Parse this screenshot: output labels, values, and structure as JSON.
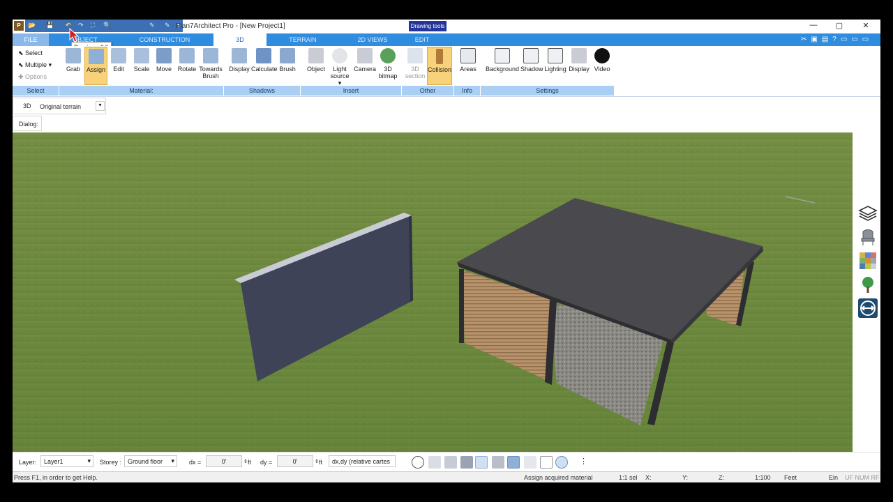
{
  "window": {
    "title": "Plan7Architect Pro - [New Project1]",
    "context_tag": "Drawing tools",
    "minimize": "—",
    "maximize": "▢",
    "close": "✕"
  },
  "tooltip": "Previous (U)",
  "tabs": [
    {
      "label": "FILE"
    },
    {
      "label": "OBJECT"
    },
    {
      "label": "CONSTRUCTION"
    },
    {
      "label": "3D"
    },
    {
      "label": "TERRAIN"
    },
    {
      "label": "2D VIEWS"
    },
    {
      "label": "EDIT"
    }
  ],
  "ribbon": {
    "select": {
      "select": "Select",
      "multiple": "Multiple",
      "options": "Options"
    },
    "material": [
      "Grab",
      "Assign",
      "Edit",
      "Scale",
      "Move",
      "Rotate",
      "Towards",
      "Brush"
    ],
    "shadows": [
      "Display",
      "Calculate",
      "Brush"
    ],
    "insert": [
      "Object",
      "Light",
      "source",
      "Camera",
      "3D",
      "bitmap"
    ],
    "other": [
      "3D",
      "section",
      "Collision"
    ],
    "info": [
      "Areas"
    ],
    "settings": [
      "Background",
      "Shadow",
      "Lighting",
      "Display",
      "Video"
    ],
    "groups": [
      "Select",
      "Material:",
      "Shadows",
      "Insert",
      "Other",
      "Info",
      "Settings"
    ]
  },
  "viewbar": {
    "mode": "3D",
    "terrain": "Original terrain"
  },
  "dialog": "Dialog:",
  "status": {
    "layer_label": "Layer:",
    "layer_value": "Layer1",
    "storey_label": "Storey :",
    "storey_value": "Ground floor",
    "dx_label": "dx =",
    "dx_value": "0'",
    "dy_label": "dy =",
    "dy_value": "0'",
    "unit": "ft",
    "coord_mode": "dx,dy (relative cartes"
  },
  "help": {
    "text": "Press F1, in order to get Help.",
    "action": "Assign acquired material",
    "selection": "1:1 sel",
    "x": "X:",
    "y": "Y:",
    "z": "Z:",
    "scale": "1:100",
    "units": "Feet",
    "ein": "Ein",
    "keys": "UF NUM RF"
  },
  "colors": {
    "tab_bar": "#2f8cde",
    "group_bar": "#a9d0f4",
    "highlight": "#f7d27a",
    "grass": "#6e8c3e",
    "roof": "#4a4a4e",
    "wall": "#3f4357"
  }
}
